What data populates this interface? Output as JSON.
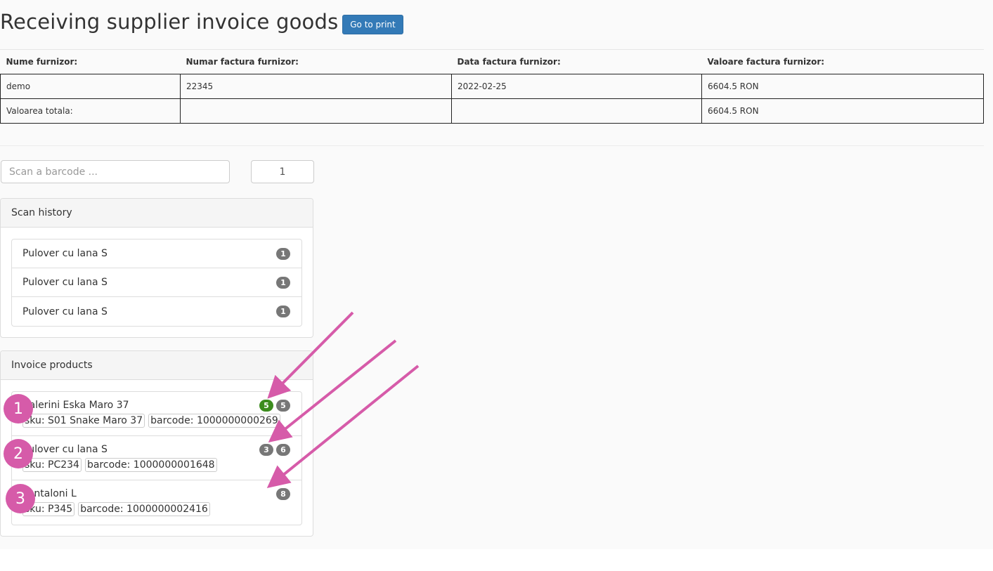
{
  "page": {
    "title": "Receiving supplier invoice goods",
    "print_button": "Go to print"
  },
  "invoice_table": {
    "headers": [
      "Nume furnizor:",
      "Numar factura furnizor:",
      "Data factura furnizor:",
      "Valoare factura furnizor:"
    ],
    "rows": [
      [
        "demo",
        "22345",
        "2022-02-25",
        "6604.5 RON"
      ],
      [
        "Valoarea totala:",
        "",
        "",
        "6604.5 RON"
      ]
    ]
  },
  "scan": {
    "placeholder": "Scan a barcode ...",
    "quantity": "1"
  },
  "scan_history": {
    "heading": "Scan history",
    "items": [
      {
        "name": "Pulover cu lana S",
        "count": "1"
      },
      {
        "name": "Pulover cu lana S",
        "count": "1"
      },
      {
        "name": "Pulover cu lana S",
        "count": "1"
      }
    ]
  },
  "invoice_products": {
    "heading": "Invoice products",
    "items": [
      {
        "name": "Balerini Eska Maro 37",
        "sku": "sku: S01 Snake Maro 37",
        "barcode": "barcode: 1000000000269",
        "scanned": "5",
        "expected": "5"
      },
      {
        "name": "Pulover cu lana S",
        "sku": "sku: PC234",
        "barcode": "barcode: 1000000001648",
        "scanned": "3",
        "expected": "6"
      },
      {
        "name": "Pantaloni L",
        "sku": "sku: P345",
        "barcode": "barcode: 1000000002416",
        "expected": "8"
      }
    ]
  },
  "annotations": {
    "markers": [
      "1",
      "2",
      "3"
    ],
    "color": "#d65ba9"
  },
  "colors": {
    "primary_button": "#337ab7",
    "badge_default": "#777777",
    "badge_success": "#3c8c1e"
  }
}
